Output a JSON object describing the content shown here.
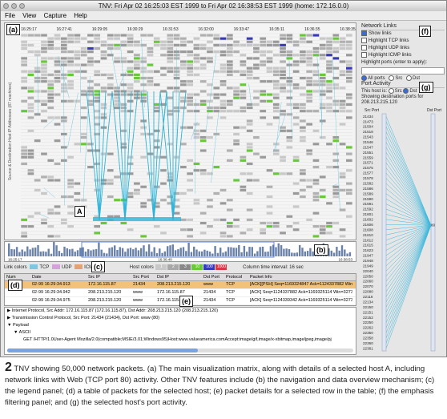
{
  "window": {
    "title": "TNV: Fri Apr 02 16:25:03 EST 1999 to Fri Apr 02 16:38:53 EST 1999 (home: 172.16.0.0)",
    "menu": [
      "File",
      "View",
      "Capture",
      "Help"
    ]
  },
  "callouts": {
    "a": "(a)",
    "A": "A",
    "b": "(b)",
    "c": "(c)",
    "d": "(d)",
    "e": "(e)",
    "f": "(f)",
    "g": "(g)"
  },
  "matrix": {
    "time_labels": [
      "16:25:17",
      "16:27:41",
      "16:29:05",
      "16:30:29",
      "16:31:53",
      "16:32:00",
      "16:33:47",
      "16:35:11",
      "16:36:35",
      "16:38:35"
    ],
    "y_axis_label": "Source & Destination Host IP Addresses (87 machines)"
  },
  "overview": {
    "start": "16:25:17",
    "cursor": "16:36:40",
    "end": "16:38:53"
  },
  "legend": {
    "link_colors_label": "Link colors",
    "link_types": [
      {
        "label": "TCP",
        "color": "#7fc6e6"
      },
      {
        "label": "UDP",
        "color": "#d9a0e0"
      },
      {
        "label": "ICMP",
        "color": "#e9a070"
      }
    ],
    "host_colors_label": "Host colors",
    "host_swatches": [
      {
        "label": "1",
        "color": "#c8c8c8"
      },
      {
        "label": "2",
        "color": "#a8a8a8"
      },
      {
        "label": "3",
        "color": "#888888"
      },
      {
        "label": "10",
        "color": "#68c838"
      },
      {
        "label": "100",
        "color": "#3838b8"
      },
      {
        "label": "1000",
        "color": "#d83848"
      }
    ],
    "interval": "Column time interval: 16 sec"
  },
  "packet_table": {
    "headers": [
      "Num",
      "Date",
      "Src IP",
      "Src Port",
      "Dst IP",
      "Dst Port",
      "Protocol",
      "Packet Info"
    ],
    "rows": [
      {
        "num": "",
        "date": "02-99 16:29:34.913",
        "src_ip": "172.16.115.87",
        "src_port": "21434",
        "dst_ip": "208.213.215.120",
        "dst_port": "www",
        "protocol": "TCP",
        "info": "[ACK][PSH] Seq=1169324847 Ack=1124337882 Win=32..."
      },
      {
        "num": "",
        "date": "02-99 16:29:34.942",
        "src_ip": "208.213.215.120",
        "src_port": "www",
        "dst_ip": "172.16.115.87",
        "dst_port": "21434",
        "protocol": "TCP",
        "info": "[ACK] Seq=1124337882 Ack=1169325114 Win=32736"
      },
      {
        "num": "",
        "date": "02-99 16:29:34.975",
        "src_ip": "208.213.215.120",
        "src_port": "www",
        "dst_ip": "172.16.115.87",
        "dst_port": "21434",
        "protocol": "TCP",
        "info": "[ACK] Seq=1124339342 Ack=1169325114 Win=32736"
      }
    ]
  },
  "packet_details": {
    "lines": [
      "Internet Protocol, Src Addr: 172.16.115.87 (172.16.115.87), Dst Addr: 208.213.215.120 (208.213.215.120)",
      "Transmission Control Protocol, Src Port: 21434 (21434), Dst Port: www (80)",
      "Payload",
      "ASCII",
      "GET /HTTP/1.0User-Agent Mozilla/2.0(compatible;MSIE/3.01;Windows95)Host:www.valueamerica.comAccept:image/gif,image/x-xbitmap,image/jpeg,image/pj"
    ]
  },
  "network_links": {
    "title": "Network Links",
    "options": [
      {
        "label": "Show links",
        "checked": true
      },
      {
        "label": "Highlight TCP links",
        "checked": false
      },
      {
        "label": "Highlight UDP links",
        "checked": false
      },
      {
        "label": "Highlight ICMP links",
        "checked": false
      }
    ],
    "ports_label": "Highlight ports (enter to apply):",
    "port_choices": [
      {
        "label": "All ports",
        "checked": true
      },
      {
        "label": "Src",
        "checked": false
      },
      {
        "label": "Dst",
        "checked": false
      }
    ]
  },
  "port_activity": {
    "title": "Port Activity",
    "host_is_label": "This host is:",
    "host_choices": [
      "Src",
      "Dst"
    ],
    "showing_label": "Showing destination ports for",
    "host_ip": "208.213.215.120",
    "src_port_header": "Src Port",
    "dst_port_header": "Dst Port",
    "src_ports": [
      "21434",
      "21473",
      "21504",
      "21518",
      "21543",
      "21546",
      "21547",
      "21551",
      "21559",
      "21571",
      "21575",
      "21577",
      "21578",
      "21582",
      "21586",
      "21589",
      "21590",
      "21591",
      "21592",
      "21601",
      "21602",
      "21606",
      "21608",
      "21610",
      "21612",
      "21615",
      "21623",
      "21947",
      "21948",
      "21949",
      "22040",
      "22050",
      "22060",
      "22070",
      "22080",
      "22116",
      "22134",
      "22150",
      "22151",
      "22152",
      "22250",
      "22262",
      "22350",
      "22358",
      "22360",
      "22361"
    ],
    "dst_port": "80"
  },
  "caption": {
    "number": "2",
    "text": "TNV showing 50,000 network packets. (a) The main visualization matrix, along with details of a selected host A, including network links with Web (TCP port 80) activity. Other TNV features include (b) the navigation and data overview mechanism; (c) the legend panel; (d) a table of packets for the selected host; (e) packet details for a selected row in the table; (f) the emphasis filtering panel; and (g) the selected host's port activity."
  }
}
